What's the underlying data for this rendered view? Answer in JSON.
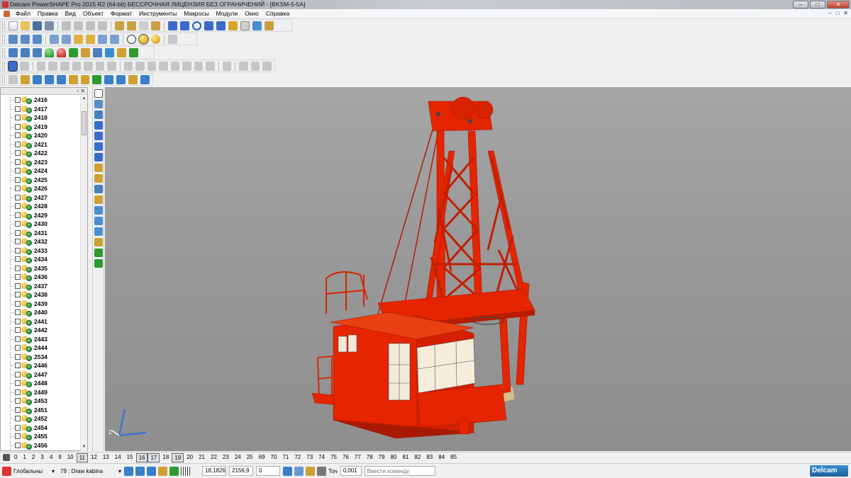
{
  "window": {
    "title": "Delcam PowerSHAPE Pro 2015 R2 (64-bit) БЕССРОЧНАЯ ЛИЦЕНЗИЯ БЕЗ ОГРАНИЧЕНИЙ - [BKSM-5-5A]",
    "min_label": "–",
    "max_label": "□",
    "close_label": "✕"
  },
  "menu": [
    "Файл",
    "Правка",
    "Вид",
    "Объект",
    "Формат",
    "Инструменты",
    "Макросы",
    "Модули",
    "Окно",
    "Справка"
  ],
  "mdi_controls": [
    "–",
    "□",
    "✕"
  ],
  "tree": {
    "header_controls": "▫ ✕",
    "items": [
      "2416",
      "2417",
      "2418",
      "2419",
      "2420",
      "2421",
      "2422",
      "2423",
      "2424",
      "2425",
      "2426",
      "2427",
      "2428",
      "2429",
      "2430",
      "2431",
      "2432",
      "2433",
      "2434",
      "2435",
      "2436",
      "2437",
      "2438",
      "2439",
      "2440",
      "2441",
      "2442",
      "2443",
      "2444",
      "2534",
      "2446",
      "2447",
      "2448",
      "2449",
      "2453",
      "2451",
      "2452",
      "2454",
      "2455",
      "2456"
    ]
  },
  "levels": {
    "items": [
      "0",
      "1",
      "2",
      "3",
      "4",
      "9",
      "10",
      "11",
      "12",
      "13",
      "14",
      "15",
      "16",
      "17",
      "18",
      "19",
      "20",
      "21",
      "22",
      "23",
      "24",
      "25",
      "69",
      "70",
      "71",
      "72",
      "73",
      "74",
      "75",
      "76",
      "77",
      "78",
      "79",
      "80",
      "81",
      "82",
      "83",
      "84",
      "85"
    ],
    "active": [
      "11",
      "16",
      "17",
      "19"
    ]
  },
  "status": {
    "workplane": "Глобальны",
    "level": "79 : Draw kabina",
    "x": "18,1826",
    "y": "2156,9",
    "z": "0",
    "tolerance_label": "Точ",
    "tolerance": "0,001",
    "command_placeholder": "Ввести команду",
    "brand": "Delcam"
  },
  "colors": {
    "model_red": "#e52400",
    "model_dark": "#b81c00",
    "platform_tan": "#e8d2a8",
    "viewport_top": "#a6a6a6"
  },
  "icons": {
    "toolbar_row1": [
      "new-file-icon",
      "open-folder-icon",
      "save-icon",
      "print-icon",
      "cut-icon",
      "copy-icon",
      "paste-icon",
      "delete-icon",
      "undo-icon",
      "redo-icon",
      "select-icon",
      "measure-icon",
      "line-icon",
      "arc-icon",
      "circle-icon",
      "curve-icon",
      "text-icon",
      "dimension-icon",
      "shade-icon",
      "solid-icon",
      "tools-icon"
    ],
    "toolbar_row2": [
      "view-iso-icon",
      "view-front-icon",
      "view-top-icon",
      "rotate-icon",
      "zoom-icon",
      "zoom-window-icon",
      "pan-icon",
      "globe-icon",
      "shaded-sphere-icon",
      "light-icon",
      "scissors-icon"
    ],
    "toolbar_row3": [
      "surface-icon",
      "doc-icon",
      "layers-icon",
      "green-dome-icon",
      "red-dome-icon",
      "arrow-icon",
      "box-icon",
      "mesh-icon",
      "assembly-icon"
    ],
    "toolbar_row4": [
      "select-mode-icon",
      "pick-icon",
      "solid-feature-icons-disabled"
    ],
    "toolbar_row5": [
      "sphere-icon",
      "axis-icon",
      "block-icon",
      "cylinder-icon",
      "cone-icon",
      "torus-icon",
      "spring-icon",
      "extrude-icon",
      "revolve-icon"
    ]
  }
}
